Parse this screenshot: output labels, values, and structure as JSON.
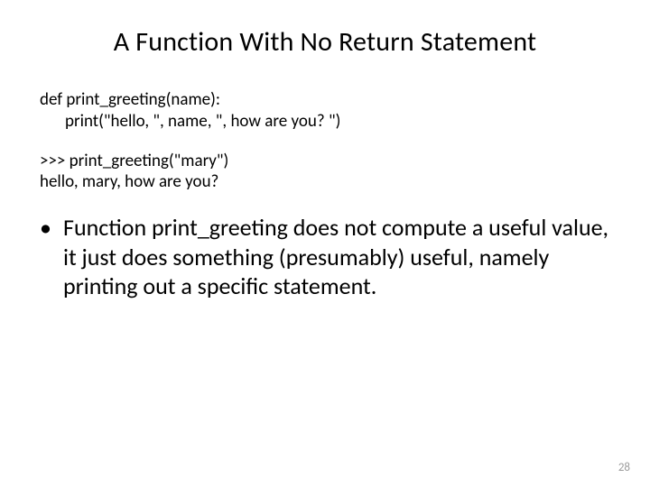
{
  "title": "A Function With No Return Statement",
  "code": {
    "line1": "def print_greeting(name):",
    "line2": "print(\"hello, \", name, \", how are you? \")"
  },
  "repl": {
    "line1": ">>> print_greeting(\"mary\")",
    "line2": "hello, mary, how are you?"
  },
  "bullet": {
    "marker": "•",
    "text": "Function print_greeting does not compute a useful value, it just does something (presumably) useful, namely printing out a specific statement."
  },
  "page_number": "28"
}
